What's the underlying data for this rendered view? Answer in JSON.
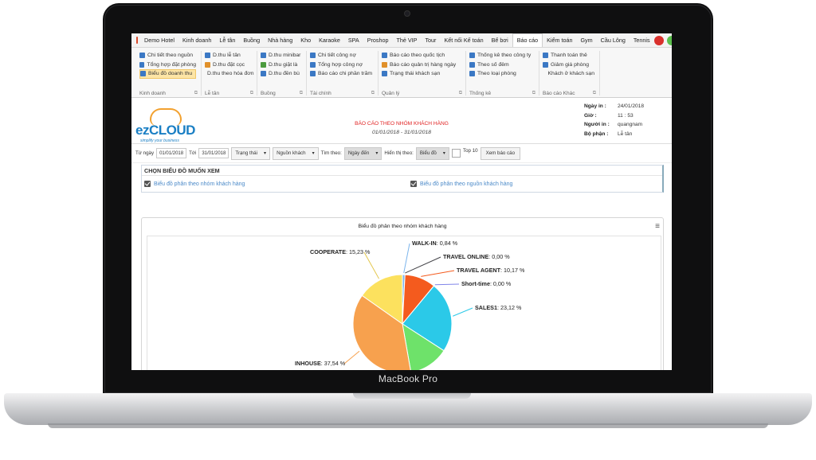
{
  "device": {
    "label": "MacBook Pro"
  },
  "menu": {
    "items": [
      "Demo Hotel",
      "Kinh doanh",
      "Lễ tân",
      "Buồng",
      "Nhà hàng",
      "Kho",
      "Karaoke",
      "SPA",
      "Proshop",
      "Thẻ VIP",
      "Tour",
      "Kết nối Kế toán",
      "Bể bơi",
      "Báo cáo",
      "Kiểm toán",
      "Gym",
      "Cầu Lông",
      "Tennis"
    ],
    "active_index": 13
  },
  "ribbon": {
    "groups": [
      {
        "title": "Kinh doanh",
        "items": [
          "Chi tiết theo nguồn",
          "Tổng hợp đặt phòng",
          "Biểu đồ doanh thu"
        ],
        "selected": 2
      },
      {
        "title": "Lễ tân",
        "items": [
          "D.thu lễ tân",
          "D.thu đặt cọc",
          "D.thu theo hóa đơn"
        ]
      },
      {
        "title": "Buồng",
        "items": [
          "D.thu minibar",
          "D.thu giặt là",
          "D.thu đền bù"
        ]
      },
      {
        "title": "Tài chính",
        "items": [
          "Chi tiết công nợ",
          "Tổng hợp công nợ",
          "Báo cáo chi phần trăm"
        ]
      },
      {
        "title": "Quản lý",
        "items": [
          "Báo cáo theo quốc tịch",
          "Báo cáo quản trị hàng ngày",
          "Trạng thái khách sạn"
        ]
      },
      {
        "title": "Thống kê",
        "items": [
          "Thống kê theo công ty",
          "Theo số đêm",
          "Theo loại phòng"
        ]
      },
      {
        "title": "Báo cáo Khác",
        "items": [
          "Thanh toán thẻ",
          "Giảm giá phòng",
          "Khách ở khách sạn"
        ]
      }
    ]
  },
  "report": {
    "logo": "ezCLOUD",
    "logo_tagline": "simplify your business",
    "title": "BÁO CÁO THEO NHÓM KHÁCH HÀNG",
    "date_range": "01/01/2018 - 31/01/2018",
    "meta": [
      {
        "k": "Ngày in :",
        "v": "24/01/2018"
      },
      {
        "k": "Giờ :",
        "v": "11 : 53"
      },
      {
        "k": "Người in :",
        "v": "quangnam"
      },
      {
        "k": "Bộ phận :",
        "v": "Lễ tân"
      }
    ]
  },
  "filters": {
    "from_label": "Từ ngày",
    "from_value": "01/01/2018",
    "to_label": "Tới",
    "to_value": "31/01/2018",
    "status": "Trạng thái",
    "source": "Nguồn khách",
    "search_label": "Tìm theo:",
    "search_value": "Ngày đến",
    "display_label": "Hiển thị theo:",
    "display_value": "Biểu đồ",
    "top10": "Top 10",
    "submit": "Xem báo cáo"
  },
  "chart_select": {
    "heading": "CHỌN BIỂU ĐỒ MUỐN XEM",
    "option1": "Biểu đồ phân theo nhóm khách hàng",
    "option2": "Biểu đồ phân theo nguồn khách hàng"
  },
  "chart_data": {
    "type": "pie",
    "title": "Biểu đồ phân theo nhóm khách hàng",
    "slices": [
      {
        "name": "WALK-IN",
        "value": 0.84,
        "label": "0,84 %",
        "color": "#7cb5ec"
      },
      {
        "name": "TRAVEL ONLINE",
        "value": 0.0,
        "label": "0,00 %",
        "color": "#434348"
      },
      {
        "name": "TRAVEL AGENT",
        "value": 10.17,
        "label": "10,17 %",
        "color": "#f45b1e"
      },
      {
        "name": "Short-time",
        "value": 0.0,
        "label": "0,00 %",
        "color": "#8085e9"
      },
      {
        "name": "SALES1",
        "value": 23.12,
        "label": "23,12 %",
        "color": "#2bc9e8"
      },
      {
        "name": "",
        "value": 13.1,
        "label": "",
        "color": "#6ee26a"
      },
      {
        "name": "INHOUSE",
        "value": 37.54,
        "label": "37,54 %",
        "color": "#f7a14e"
      },
      {
        "name": "COOPERATE",
        "value": 15.23,
        "label": "15,23 %",
        "color": "#fce15e"
      }
    ]
  }
}
